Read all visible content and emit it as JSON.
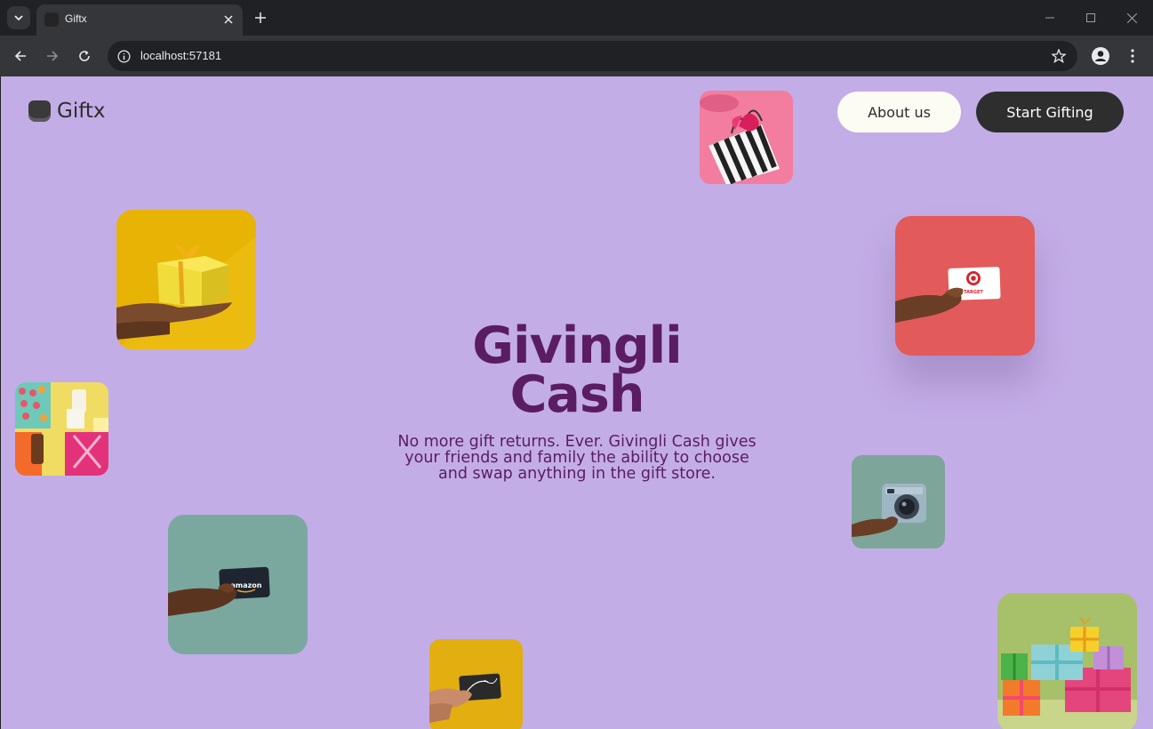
{
  "browser": {
    "tab_title": "Giftx",
    "url": "localhost:57181"
  },
  "page": {
    "logo_text": "Giftx",
    "nav": {
      "about_label": "About us",
      "start_label": "Start Gifting"
    },
    "hero": {
      "title_line1": "Givingli",
      "title_line2": "Cash",
      "subtitle": "No more gift returns. Ever. Givingli Cash gives your friends and family the ability to choose and swap anything in the gift store."
    },
    "images": [
      {
        "name": "striped-shopping-bag-image",
        "card_text": ""
      },
      {
        "name": "yellow-gift-box-image",
        "card_text": ""
      },
      {
        "name": "target-gift-card-image",
        "card_text": "TARGET"
      },
      {
        "name": "gift-assortment-image",
        "card_text": ""
      },
      {
        "name": "amazon-gift-card-image",
        "card_text": "amazon"
      },
      {
        "name": "instant-camera-image",
        "card_text": ""
      },
      {
        "name": "gift-card-yellow-image",
        "card_text": ""
      },
      {
        "name": "colorful-gift-stack-image",
        "card_text": ""
      }
    ]
  },
  "colors": {
    "page_bg": "#c3ade7",
    "title": "#5a1c63",
    "about_bg": "#fdfcf2",
    "start_bg": "#2e2e2e"
  }
}
